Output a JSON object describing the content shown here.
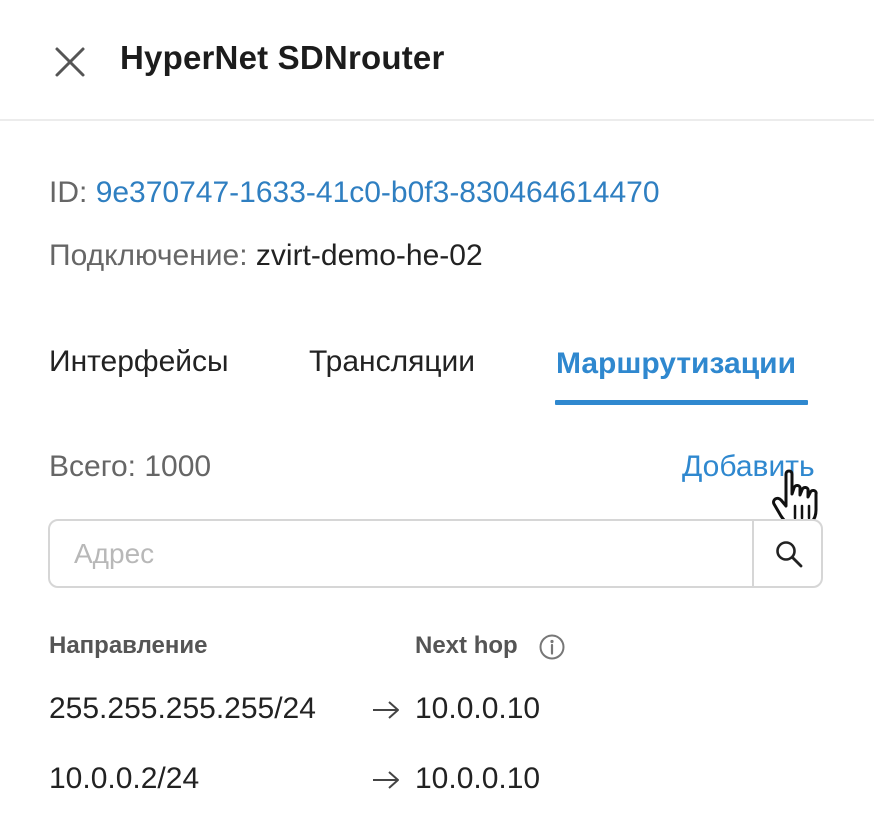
{
  "header": {
    "title": "HyperNet SDNrouter",
    "close_icon": "close-icon"
  },
  "info": {
    "id_label": "ID:",
    "id_value": "9e370747-1633-41c0-b0f3-830464614470",
    "connection_label": "Подключение:",
    "connection_value": "zvirt-demo-he-02"
  },
  "tabs": [
    {
      "label": "Интерфейсы",
      "active": false
    },
    {
      "label": "Трансляции",
      "active": false
    },
    {
      "label": "Маршрутизации",
      "active": true
    }
  ],
  "routes": {
    "total_label": "Всего: 1000",
    "add_label": "Добавить",
    "search_placeholder": "Адрес",
    "search_icon": "search-icon",
    "columns": {
      "destination": "Направление",
      "next_hop": "Next hop",
      "next_hop_info_icon": "info-icon"
    },
    "rows": [
      {
        "destination": "255.255.255.255/24",
        "next_hop": "10.0.0.10"
      },
      {
        "destination": "10.0.0.2/24",
        "next_hop": "10.0.0.10"
      }
    ]
  },
  "colors": {
    "accent": "#2f88cf",
    "link": "#2f7fc1",
    "muted_text": "#666666",
    "border": "#d6d6d6"
  }
}
